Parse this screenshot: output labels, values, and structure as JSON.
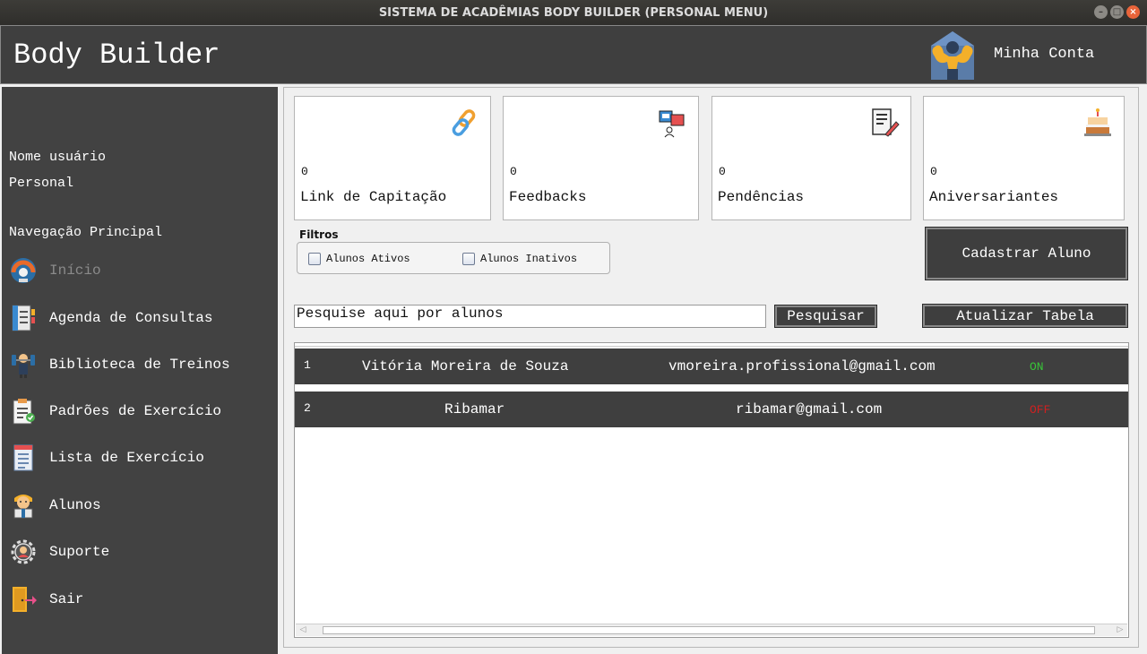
{
  "window": {
    "title": "SISTEMA DE ACADÊMIAS BODY BUILDER (PERSONAL MENU)"
  },
  "header": {
    "app_name": "Body Builder",
    "account_label": "Minha Conta"
  },
  "sidebar": {
    "user_name": "Nome usuário",
    "role": "Personal",
    "section_title": "Navegação Principal",
    "items": [
      {
        "label": "Início",
        "icon": "dashboard-gauge-icon"
      },
      {
        "label": "Agenda de Consultas",
        "icon": "agenda-notebook-icon"
      },
      {
        "label": "Biblioteca de Treinos",
        "icon": "dumbbell-icon"
      },
      {
        "label": "Padrões de Exercício",
        "icon": "clipboard-check-icon"
      },
      {
        "label": "Lista de Exercício",
        "icon": "list-document-icon"
      },
      {
        "label": "Alunos",
        "icon": "students-icon"
      },
      {
        "label": "Suporte",
        "icon": "support-gear-icon"
      },
      {
        "label": "Sair",
        "icon": "exit-door-icon"
      }
    ]
  },
  "cards": [
    {
      "count": "0",
      "label": "Link de Capitação",
      "icon": "link-icon"
    },
    {
      "count": "0",
      "label": "Feedbacks",
      "icon": "feedback-chat-icon"
    },
    {
      "count": "0",
      "label": "Pendências",
      "icon": "pending-document-icon"
    },
    {
      "count": "0",
      "label": "Aniversariantes",
      "icon": "birthday-cake-icon"
    }
  ],
  "filters": {
    "title": "Filtros",
    "active_label": "Alunos Ativos",
    "inactive_label": "Alunos Inativos"
  },
  "buttons": {
    "register": "Cadastrar Aluno",
    "search": "Pesquisar",
    "refresh": "Atualizar Tabela"
  },
  "search": {
    "value": "Pesquise aqui por alunos"
  },
  "table": {
    "rows": [
      {
        "id": "1",
        "name": "Vitória Moreira de Souza",
        "email": "vmoreira.profissional@gmail.com",
        "status": "ON"
      },
      {
        "id": "2",
        "name": "Ribamar",
        "email": "ribamar@gmail.com",
        "status": "OFF"
      }
    ]
  },
  "colors": {
    "dark_panel": "#3f3f3f",
    "status_on": "#38c638",
    "status_off": "#d02020"
  }
}
